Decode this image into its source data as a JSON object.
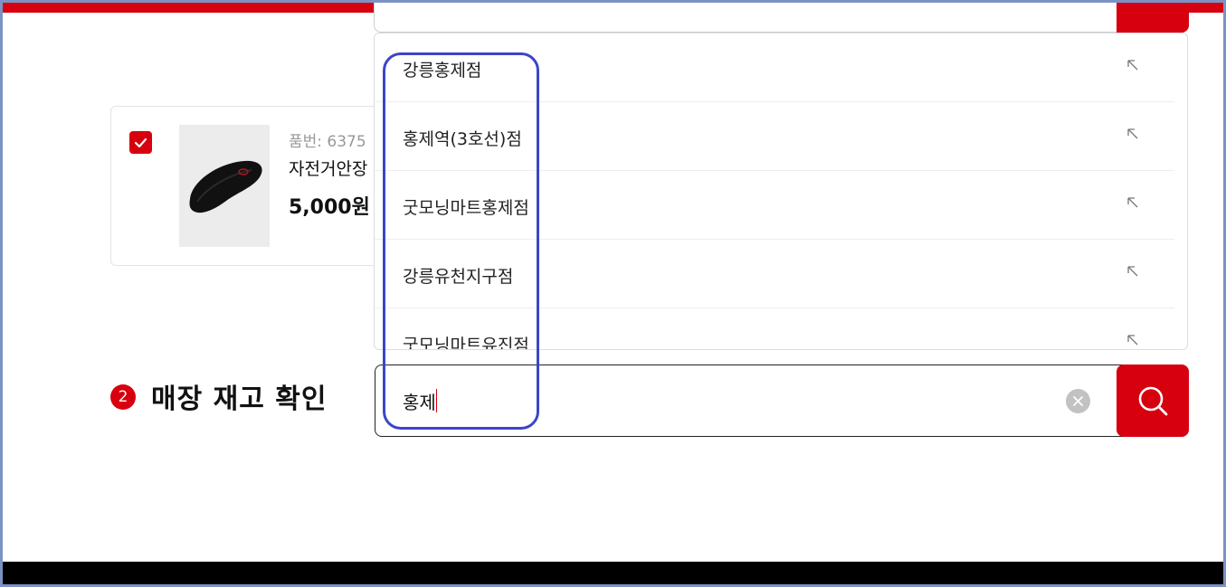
{
  "colors": {
    "accent": "#d7000f",
    "annotation": "#3b46c8",
    "border": "#e4e4e4",
    "muted_text": "#999999"
  },
  "product": {
    "code_label": "품번: 6375",
    "name": "자전거안장",
    "price": "5,000원",
    "checked": true,
    "checkbox_icon": "checkmark-icon",
    "image_icon": "bicycle-saddle-cover-image"
  },
  "dropdown": {
    "arrow_icon": "arrow-up-left-icon",
    "suggestions": [
      {
        "label": "강릉홍제점"
      },
      {
        "label": "홍제역(3호선)점"
      },
      {
        "label": "굿모닝마트홍제점"
      },
      {
        "label": "강릉유천지구점"
      },
      {
        "label": "굿모닝마트유진점"
      }
    ]
  },
  "section": {
    "step": "2",
    "title": "매장 재고 확인"
  },
  "search": {
    "value": "홍제",
    "clear_icon": "clear-x-icon",
    "button_icon": "search-icon"
  }
}
